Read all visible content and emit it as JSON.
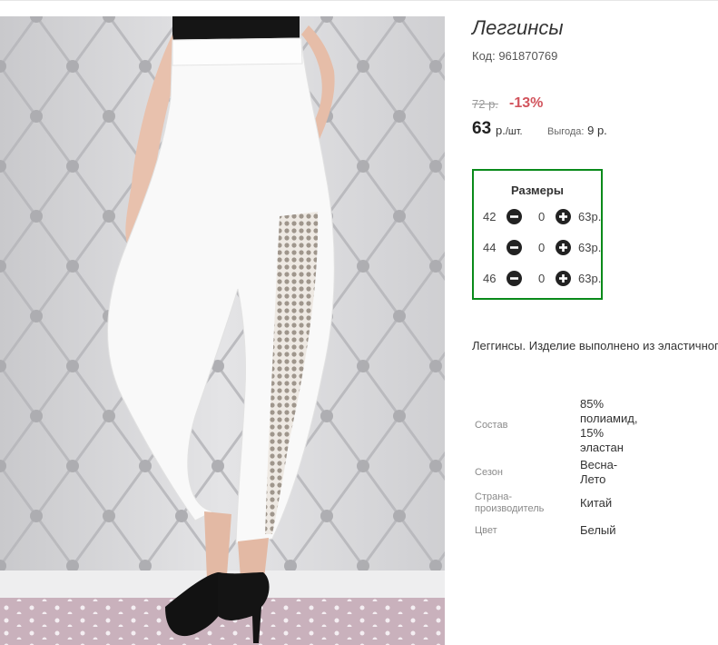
{
  "product": {
    "title": "Леггинсы",
    "code": "Код: 961870769",
    "old_price": "72 р.",
    "discount": "-13%",
    "price": "63",
    "price_unit_main": "р.",
    "price_unit_small": "/шт.",
    "savings_label": "Выгода:",
    "savings_value": "9 р."
  },
  "sizes": {
    "title": "Размеры",
    "rows": [
      {
        "size": "42",
        "qty": "0",
        "price": "63р."
      },
      {
        "size": "44",
        "qty": "0",
        "price": "63р."
      },
      {
        "size": "46",
        "qty": "0",
        "price": "63р."
      }
    ]
  },
  "description": "Леггинсы. Изделие выполнено из эластичного",
  "attributes": {
    "composition_label": "Состав",
    "composition_lines": [
      "85%",
      "полиамид,",
      "15%",
      "эластан"
    ],
    "season_label": "Сезон",
    "season_lines": [
      "Весна-",
      "Лето"
    ],
    "country_label_lines": [
      "Страна-",
      "производитель"
    ],
    "country_value": "Китай",
    "color_label": "Цвет",
    "color_value": "Белый"
  },
  "colors": {
    "sizes_border": "#0a8a1a",
    "discount": "#d2545d",
    "old_price": "#9a9a9a"
  },
  "icons": {
    "minus": "minus-circle-icon",
    "plus": "plus-circle-icon"
  }
}
